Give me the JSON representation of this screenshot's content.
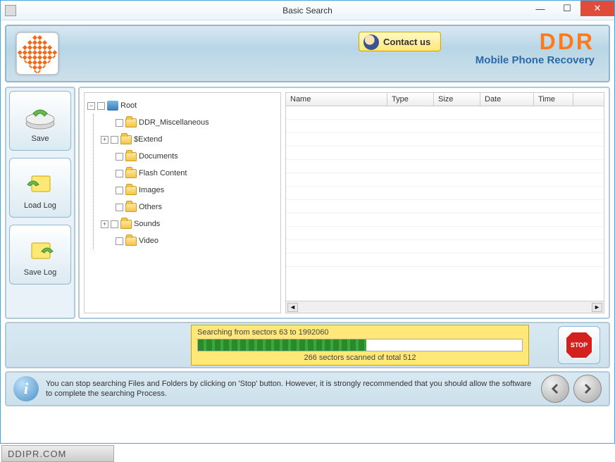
{
  "window": {
    "title": "Basic Search"
  },
  "header": {
    "contact_label": "Contact us",
    "brand": "DDR",
    "brand_sub": "Mobile Phone Recovery"
  },
  "sidebar": {
    "save": "Save",
    "load_log": "Load Log",
    "save_log": "Save Log"
  },
  "tree": {
    "root": "Root",
    "items": [
      "DDR_Miscellaneous",
      "$Extend",
      "Documents",
      "Flash Content",
      "Images",
      "Others",
      "Sounds",
      "Video"
    ]
  },
  "grid": {
    "cols": {
      "name": "Name",
      "type": "Type",
      "size": "Size",
      "date": "Date",
      "time": "Time"
    }
  },
  "progress": {
    "line1": "Searching from sectors 63 to 1992060",
    "line2": "266  sectors scanned of total 512",
    "stop": "STOP"
  },
  "hint": "You can stop searching Files and Folders by clicking on 'Stop' button. However, it is strongly recommended that you should allow the software to complete the searching Process.",
  "footer": "DDIPR.COM"
}
